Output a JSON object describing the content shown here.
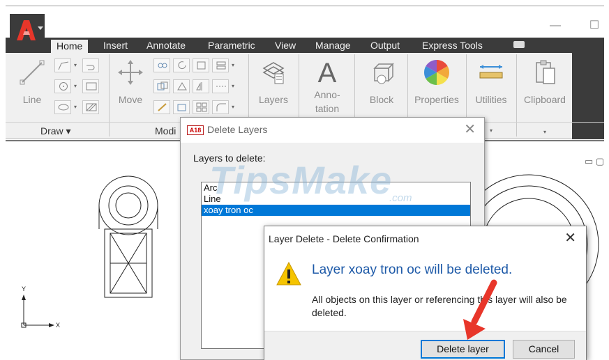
{
  "window": {
    "minimize_glyph": "—",
    "maximize_glyph": "☐"
  },
  "tabs": [
    {
      "label": "Home",
      "active": true
    },
    {
      "label": "Insert"
    },
    {
      "label": "Annotate"
    },
    {
      "label": "Parametric"
    },
    {
      "label": "View"
    },
    {
      "label": "Manage"
    },
    {
      "label": "Output"
    },
    {
      "label": "Express Tools"
    }
  ],
  "ribbon": {
    "line_label": "Line",
    "move_label": "Move",
    "layers_label": "Layers",
    "annotation_label_1": "Anno-",
    "annotation_label_2": "tation",
    "block_label": "Block",
    "properties_label": "Properties",
    "utilities_label": "Utilities",
    "clipboard_label": "Clipboard",
    "draw_panel_title": "Draw ▾",
    "modify_panel_title": "Modi"
  },
  "axis": {
    "y": "Y",
    "x": "X"
  },
  "delete_layers_dialog": {
    "icon_text": "A18",
    "title": "Delete Layers",
    "label": "Layers to delete:",
    "layers": [
      "Arc",
      "Line",
      "xoay tron oc"
    ],
    "selected_index": 2
  },
  "watermark": {
    "text": "TipsMake",
    "sub": ".com"
  },
  "confirm_dialog": {
    "title": "Layer Delete - Delete Confirmation",
    "main_message": "Layer xoay tron oc will be deleted.",
    "detail_message": "All objects on this layer or referencing this layer will also be deleted.",
    "delete_button": "Delete layer",
    "cancel_button": "Cancel"
  },
  "colors": {
    "accent": "#0078d7",
    "ribbon_dark": "#3b3b3b",
    "message_blue": "#1e5aa8",
    "warning_yellow": "#f5c400",
    "annotation_red": "#e8362a"
  }
}
